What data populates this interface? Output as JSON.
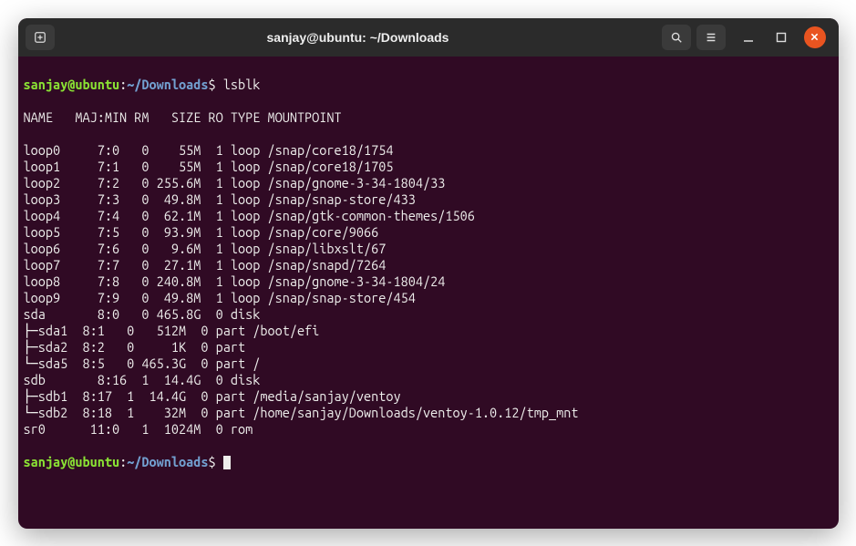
{
  "title": "sanjay@ubuntu: ~/Downloads",
  "prompt": {
    "user_host": "sanjay@ubuntu",
    "sep1": ":",
    "path": "~/Downloads",
    "dollar": "$"
  },
  "command": "lsblk",
  "header": "NAME   MAJ:MIN RM   SIZE RO TYPE MOUNTPOINT",
  "rows": [
    {
      "tree": "",
      "name": "loop0",
      "maj": "   7:0",
      "rm": "   0",
      "size": "   55M",
      "ro": "  1",
      "type": "loop",
      "mnt": " /snap/core18/1754"
    },
    {
      "tree": "",
      "name": "loop1",
      "maj": "   7:1",
      "rm": "   0",
      "size": "   55M",
      "ro": "  1",
      "type": "loop",
      "mnt": " /snap/core18/1705"
    },
    {
      "tree": "",
      "name": "loop2",
      "maj": "   7:2",
      "rm": "   0",
      "size": "255.6M",
      "ro": "  1",
      "type": "loop",
      "mnt": " /snap/gnome-3-34-1804/33"
    },
    {
      "tree": "",
      "name": "loop3",
      "maj": "   7:3",
      "rm": "   0",
      "size": " 49.8M",
      "ro": "  1",
      "type": "loop",
      "mnt": " /snap/snap-store/433"
    },
    {
      "tree": "",
      "name": "loop4",
      "maj": "   7:4",
      "rm": "   0",
      "size": " 62.1M",
      "ro": "  1",
      "type": "loop",
      "mnt": " /snap/gtk-common-themes/1506"
    },
    {
      "tree": "",
      "name": "loop5",
      "maj": "   7:5",
      "rm": "   0",
      "size": " 93.9M",
      "ro": "  1",
      "type": "loop",
      "mnt": " /snap/core/9066"
    },
    {
      "tree": "",
      "name": "loop6",
      "maj": "   7:6",
      "rm": "   0",
      "size": "  9.6M",
      "ro": "  1",
      "type": "loop",
      "mnt": " /snap/libxslt/67"
    },
    {
      "tree": "",
      "name": "loop7",
      "maj": "   7:7",
      "rm": "   0",
      "size": " 27.1M",
      "ro": "  1",
      "type": "loop",
      "mnt": " /snap/snapd/7264"
    },
    {
      "tree": "",
      "name": "loop8",
      "maj": "   7:8",
      "rm": "   0",
      "size": "240.8M",
      "ro": "  1",
      "type": "loop",
      "mnt": " /snap/gnome-3-34-1804/24"
    },
    {
      "tree": "",
      "name": "loop9",
      "maj": "   7:9",
      "rm": "   0",
      "size": " 49.8M",
      "ro": "  1",
      "type": "loop",
      "mnt": " /snap/snap-store/454"
    },
    {
      "tree": "",
      "name": "sda  ",
      "maj": "   8:0",
      "rm": "   0",
      "size": "465.8G",
      "ro": "  0",
      "type": "disk",
      "mnt": ""
    },
    {
      "tree": "├─",
      "name": "sda1 ",
      "maj": " 8:1",
      "rm": "   0",
      "size": "  512M",
      "ro": "  0",
      "type": "part",
      "mnt": " /boot/efi"
    },
    {
      "tree": "├─",
      "name": "sda2 ",
      "maj": " 8:2",
      "rm": "   0",
      "size": "    1K",
      "ro": "  0",
      "type": "part",
      "mnt": ""
    },
    {
      "tree": "└─",
      "name": "sda5 ",
      "maj": " 8:5",
      "rm": "   0",
      "size": "465.3G",
      "ro": "  0",
      "type": "part",
      "mnt": " /"
    },
    {
      "tree": "",
      "name": "sdb  ",
      "maj": "   8:16",
      "rm": "  1",
      "size": " 14.4G",
      "ro": "  0",
      "type": "disk",
      "mnt": ""
    },
    {
      "tree": "├─",
      "name": "sdb1 ",
      "maj": " 8:17",
      "rm": "  1",
      "size": " 14.4G",
      "ro": "  0",
      "type": "part",
      "mnt": " /media/sanjay/ventoy"
    },
    {
      "tree": "└─",
      "name": "sdb2 ",
      "maj": " 8:18",
      "rm": "  1",
      "size": "   32M",
      "ro": "  0",
      "type": "part",
      "mnt": " /home/sanjay/Downloads/ventoy-1.0.12/tmp_mnt"
    },
    {
      "tree": "",
      "name": "sr0  ",
      "maj": "  11:0",
      "rm": "   1",
      "size": " 1024M",
      "ro": "  0",
      "type": "rom ",
      "mnt": ""
    }
  ]
}
